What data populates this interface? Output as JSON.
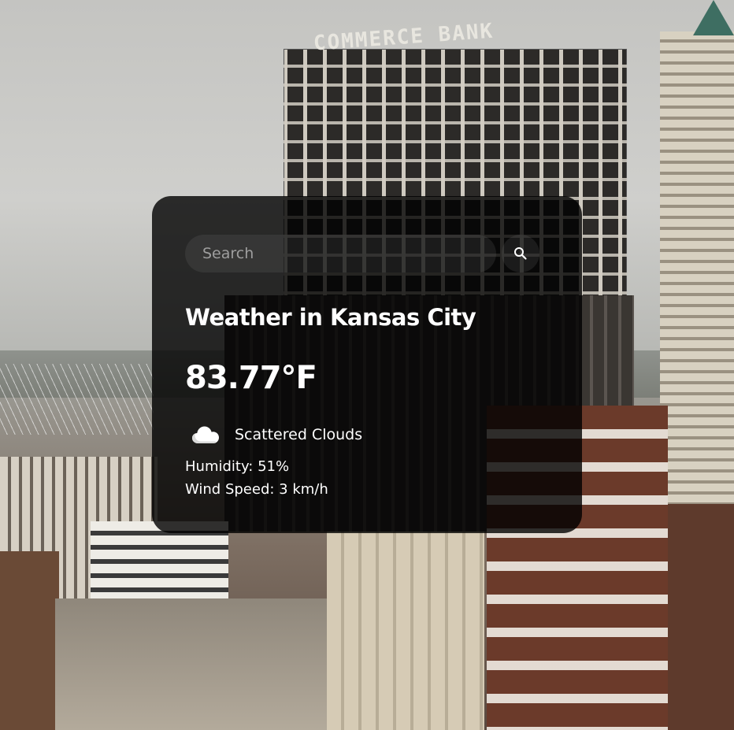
{
  "search": {
    "placeholder": "Search",
    "value": ""
  },
  "weather": {
    "title": "Weather in Kansas City",
    "temperature": "83.77°F",
    "description": "Scattered Clouds",
    "humidity": "Humidity: 51%",
    "wind": "Wind Speed: 3 km/h"
  },
  "icons": {
    "search": "search-icon",
    "condition": "cloud-icon"
  },
  "colors": {
    "card_background": "#000000cc",
    "text": "#ffffff",
    "placeholder": "#9e9e9e",
    "input_background": "#7c7c7c2b"
  }
}
